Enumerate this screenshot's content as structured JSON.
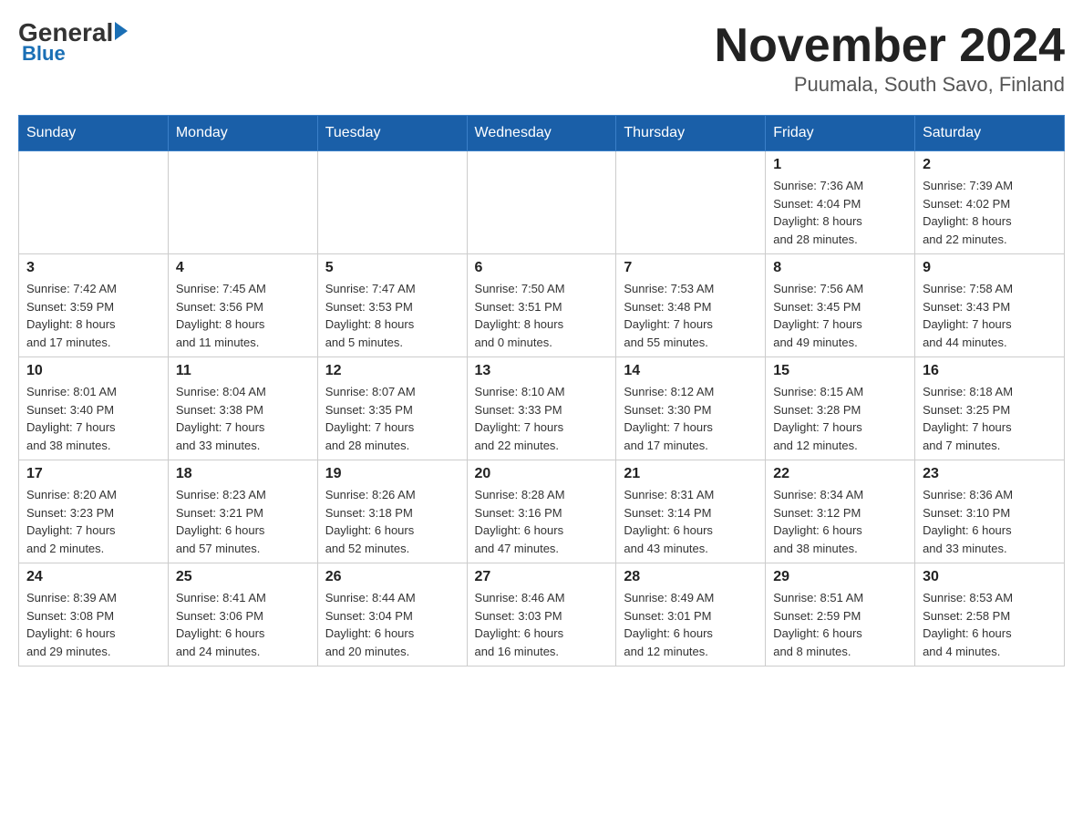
{
  "header": {
    "logo_general": "General",
    "logo_blue": "Blue",
    "main_title": "November 2024",
    "subtitle": "Puumala, South Savo, Finland"
  },
  "days_of_week": [
    "Sunday",
    "Monday",
    "Tuesday",
    "Wednesday",
    "Thursday",
    "Friday",
    "Saturday"
  ],
  "weeks": [
    [
      {
        "day": "",
        "info": ""
      },
      {
        "day": "",
        "info": ""
      },
      {
        "day": "",
        "info": ""
      },
      {
        "day": "",
        "info": ""
      },
      {
        "day": "",
        "info": ""
      },
      {
        "day": "1",
        "info": "Sunrise: 7:36 AM\nSunset: 4:04 PM\nDaylight: 8 hours\nand 28 minutes."
      },
      {
        "day": "2",
        "info": "Sunrise: 7:39 AM\nSunset: 4:02 PM\nDaylight: 8 hours\nand 22 minutes."
      }
    ],
    [
      {
        "day": "3",
        "info": "Sunrise: 7:42 AM\nSunset: 3:59 PM\nDaylight: 8 hours\nand 17 minutes."
      },
      {
        "day": "4",
        "info": "Sunrise: 7:45 AM\nSunset: 3:56 PM\nDaylight: 8 hours\nand 11 minutes."
      },
      {
        "day": "5",
        "info": "Sunrise: 7:47 AM\nSunset: 3:53 PM\nDaylight: 8 hours\nand 5 minutes."
      },
      {
        "day": "6",
        "info": "Sunrise: 7:50 AM\nSunset: 3:51 PM\nDaylight: 8 hours\nand 0 minutes."
      },
      {
        "day": "7",
        "info": "Sunrise: 7:53 AM\nSunset: 3:48 PM\nDaylight: 7 hours\nand 55 minutes."
      },
      {
        "day": "8",
        "info": "Sunrise: 7:56 AM\nSunset: 3:45 PM\nDaylight: 7 hours\nand 49 minutes."
      },
      {
        "day": "9",
        "info": "Sunrise: 7:58 AM\nSunset: 3:43 PM\nDaylight: 7 hours\nand 44 minutes."
      }
    ],
    [
      {
        "day": "10",
        "info": "Sunrise: 8:01 AM\nSunset: 3:40 PM\nDaylight: 7 hours\nand 38 minutes."
      },
      {
        "day": "11",
        "info": "Sunrise: 8:04 AM\nSunset: 3:38 PM\nDaylight: 7 hours\nand 33 minutes."
      },
      {
        "day": "12",
        "info": "Sunrise: 8:07 AM\nSunset: 3:35 PM\nDaylight: 7 hours\nand 28 minutes."
      },
      {
        "day": "13",
        "info": "Sunrise: 8:10 AM\nSunset: 3:33 PM\nDaylight: 7 hours\nand 22 minutes."
      },
      {
        "day": "14",
        "info": "Sunrise: 8:12 AM\nSunset: 3:30 PM\nDaylight: 7 hours\nand 17 minutes."
      },
      {
        "day": "15",
        "info": "Sunrise: 8:15 AM\nSunset: 3:28 PM\nDaylight: 7 hours\nand 12 minutes."
      },
      {
        "day": "16",
        "info": "Sunrise: 8:18 AM\nSunset: 3:25 PM\nDaylight: 7 hours\nand 7 minutes."
      }
    ],
    [
      {
        "day": "17",
        "info": "Sunrise: 8:20 AM\nSunset: 3:23 PM\nDaylight: 7 hours\nand 2 minutes."
      },
      {
        "day": "18",
        "info": "Sunrise: 8:23 AM\nSunset: 3:21 PM\nDaylight: 6 hours\nand 57 minutes."
      },
      {
        "day": "19",
        "info": "Sunrise: 8:26 AM\nSunset: 3:18 PM\nDaylight: 6 hours\nand 52 minutes."
      },
      {
        "day": "20",
        "info": "Sunrise: 8:28 AM\nSunset: 3:16 PM\nDaylight: 6 hours\nand 47 minutes."
      },
      {
        "day": "21",
        "info": "Sunrise: 8:31 AM\nSunset: 3:14 PM\nDaylight: 6 hours\nand 43 minutes."
      },
      {
        "day": "22",
        "info": "Sunrise: 8:34 AM\nSunset: 3:12 PM\nDaylight: 6 hours\nand 38 minutes."
      },
      {
        "day": "23",
        "info": "Sunrise: 8:36 AM\nSunset: 3:10 PM\nDaylight: 6 hours\nand 33 minutes."
      }
    ],
    [
      {
        "day": "24",
        "info": "Sunrise: 8:39 AM\nSunset: 3:08 PM\nDaylight: 6 hours\nand 29 minutes."
      },
      {
        "day": "25",
        "info": "Sunrise: 8:41 AM\nSunset: 3:06 PM\nDaylight: 6 hours\nand 24 minutes."
      },
      {
        "day": "26",
        "info": "Sunrise: 8:44 AM\nSunset: 3:04 PM\nDaylight: 6 hours\nand 20 minutes."
      },
      {
        "day": "27",
        "info": "Sunrise: 8:46 AM\nSunset: 3:03 PM\nDaylight: 6 hours\nand 16 minutes."
      },
      {
        "day": "28",
        "info": "Sunrise: 8:49 AM\nSunset: 3:01 PM\nDaylight: 6 hours\nand 12 minutes."
      },
      {
        "day": "29",
        "info": "Sunrise: 8:51 AM\nSunset: 2:59 PM\nDaylight: 6 hours\nand 8 minutes."
      },
      {
        "day": "30",
        "info": "Sunrise: 8:53 AM\nSunset: 2:58 PM\nDaylight: 6 hours\nand 4 minutes."
      }
    ]
  ]
}
